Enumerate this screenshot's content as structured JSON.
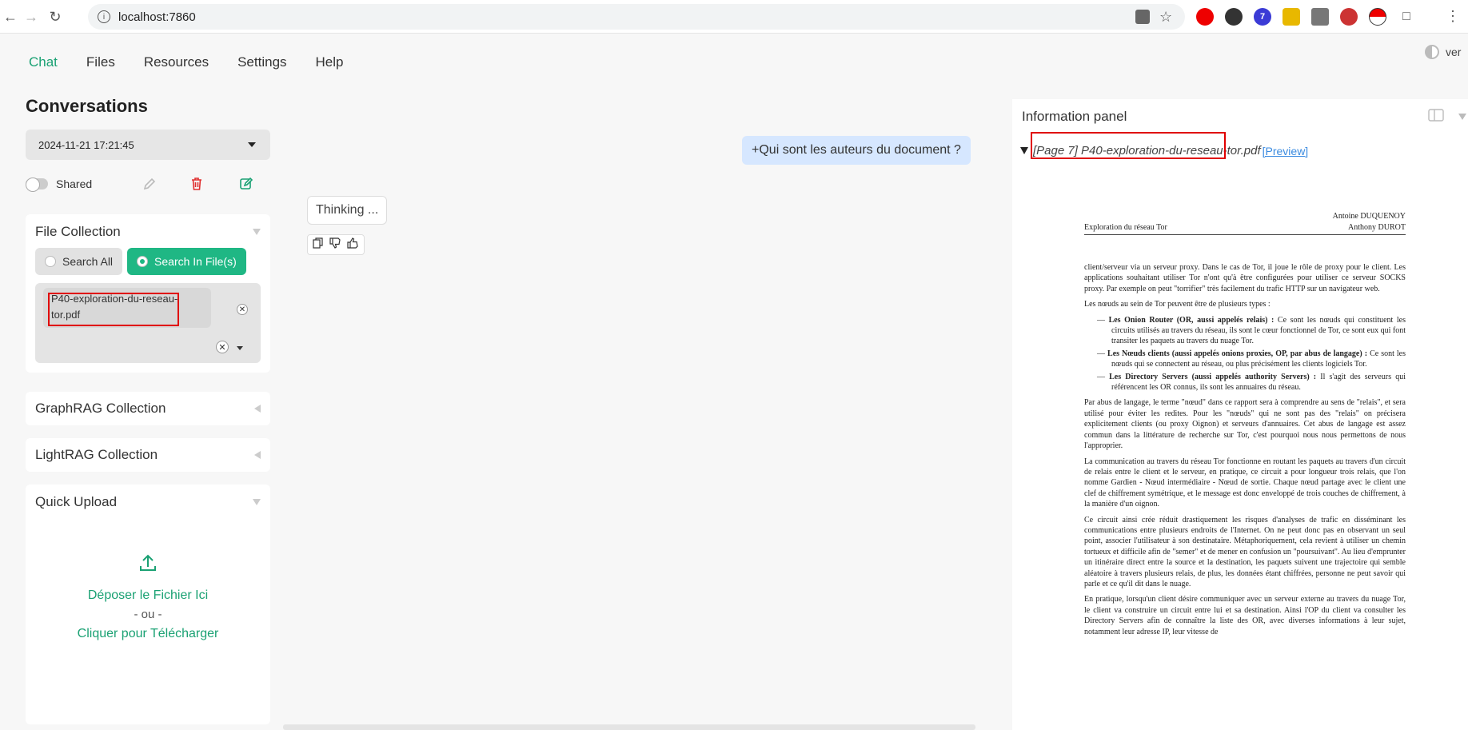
{
  "browser": {
    "url": "localhost:7860"
  },
  "nav": {
    "tabs": [
      {
        "label": "Chat",
        "active": true
      },
      {
        "label": "Files"
      },
      {
        "label": "Resources"
      },
      {
        "label": "Settings"
      },
      {
        "label": "Help"
      }
    ],
    "theme_label": "ver"
  },
  "sidebar": {
    "title": "Conversations",
    "selected_conversation": "2024-11-21 17:21:45",
    "shared_label": "Shared",
    "file_collection": {
      "title": "File Collection",
      "options": [
        "Search All",
        "Search In File(s)"
      ],
      "selected_option": "Search In File(s)",
      "selected_file": "P40-exploration-du-reseau-tor.pdf"
    },
    "graphrag_title": "GraphRAG Collection",
    "lightrag_title": "LightRAG Collection",
    "quick_upload": {
      "title": "Quick Upload",
      "drop_text": "Déposer le Fichier Ici",
      "or_text": "- ou -",
      "click_text": "Cliquer pour Télécharger"
    }
  },
  "chat": {
    "user_message": "+Qui sont les auteurs du document ?",
    "bot_message": "Thinking ..."
  },
  "info_panel": {
    "title": "Information panel",
    "source_title": "[Page 7] P40-exploration-du-reseau-tor.pdf",
    "preview_label": "[Preview]",
    "doc": {
      "header_left": "Exploration du réseau Tor",
      "header_right_1": "Antoine DUQUENOY",
      "header_right_2": "Anthony DUROT",
      "p1": "client/serveur via un serveur proxy. Dans le cas de Tor, il joue le rôle de proxy pour le client. Les applications souhaitant utiliser Tor n'ont qu'à être configurées pour utiliser ce serveur SOCKS proxy. Par exemple on peut \"torrifier\" très facilement du trafic HTTP sur un navigateur web.",
      "p2": "Les nœuds au sein de Tor peuvent être de plusieurs types :",
      "li1_bold": "Les Onion Router (OR, aussi appelés relais) :",
      "li1_text": " Ce sont les nœuds qui constituent les circuits utilisés au travers du réseau, ils sont le cœur fonctionnel de Tor, ce sont eux qui font transiter les paquets au travers du nuage Tor.",
      "li2_bold": "Les Nœuds clients (aussi appelés onions proxies, OP, par abus de langage) :",
      "li2_text": " Ce sont les nœuds qui se connectent au réseau, ou plus précisément les clients logiciels Tor.",
      "li3_bold": "Les Directory Servers (aussi appelés authority Servers) :",
      "li3_text": " Il s'agit des serveurs qui référencent les OR connus, ils sont les annuaires du réseau.",
      "p3": "Par abus de langage, le terme \"nœud\" dans ce rapport sera à comprendre au sens de \"relais\", et sera utilisé pour éviter les redites. Pour les \"nœuds\" qui ne sont pas des \"relais\" on précisera explicitement clients (ou proxy Oignon) et serveurs d'annuaires. Cet abus de langage est assez commun dans la littérature de recherche sur Tor, c'est pourquoi nous nous permettons de nous l'approprier.",
      "p4": "La communication au travers du réseau Tor fonctionne en routant les paquets au travers d'un circuit de relais entre le client et le serveur, en pratique, ce circuit a pour longueur trois relais, que l'on nomme Gardien - Nœud intermédiaire - Nœud de sortie. Chaque nœud partage avec le client une clef de chiffrement symétrique, et le message est donc enveloppé de trois couches de chiffrement, à la manière d'un oignon.",
      "p5": "Ce circuit ainsi crée réduit drastiquement les risques d'analyses de trafic en disséminant les communications entre plusieurs endroits de l'Internet. On ne peut donc pas en observant un seul point, associer l'utilisateur à son destinataire. Métaphoriquement, cela revient à utiliser un chemin tortueux et difficile afin de \"semer\" et de mener en confusion un \"poursuivant\". Au lieu d'emprunter un itinéraire direct entre la source et la destination, les paquets suivent une trajectoire qui semble aléatoire à travers plusieurs relais, de plus, les données étant chiffrées, personne ne peut savoir qui parle et ce qu'il dit dans le nuage.",
      "p6": "En pratique, lorsqu'un client désire communiquer avec un serveur externe au travers du nuage Tor, le client va construire un circuit entre lui et sa destination. Ainsi l'OP du client va consulter les Directory Servers afin de connaître la liste des OR, avec diverses informations à leur sujet, notamment leur adresse IP, leur vitesse de"
    }
  },
  "colors": {
    "accent": "#1aa173",
    "highlight": "#e00000",
    "user_bubble": "#d6e7ff"
  }
}
